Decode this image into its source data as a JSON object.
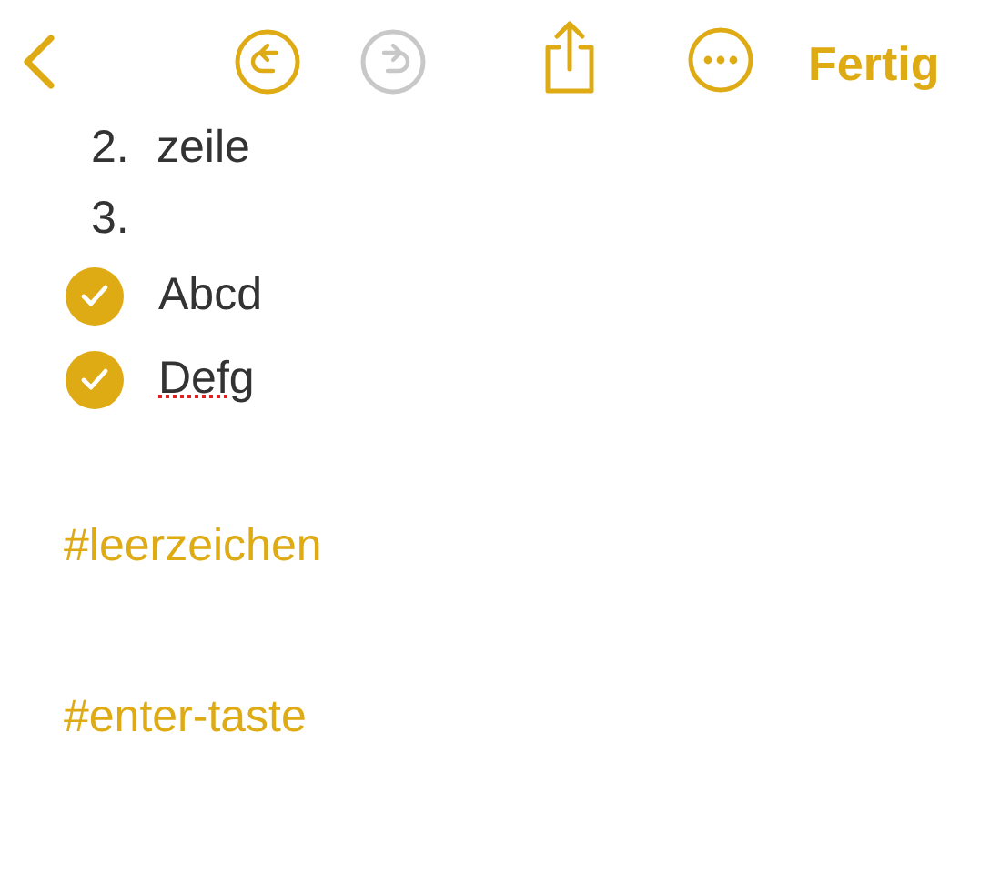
{
  "toolbar": {
    "undo": {
      "disabled": false
    },
    "redo": {
      "disabled": true
    },
    "done_label": "Fertig"
  },
  "numbered_list": [
    {
      "number": "2.",
      "text": "zeile"
    },
    {
      "number": "3."
    }
  ],
  "checklist": [
    {
      "text": "Abcd",
      "checked": true,
      "misspelled": false
    },
    {
      "text": "Defg",
      "checked": true,
      "misspelled": true
    }
  ],
  "tags": [
    "#leerzeichen",
    "#enter-taste"
  ]
}
